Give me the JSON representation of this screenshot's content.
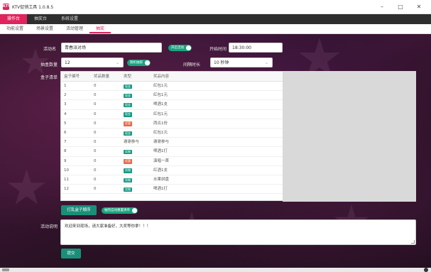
{
  "window": {
    "title": "KTV促销工具 1.0.8.5",
    "app_icon": "KTV"
  },
  "window_controls": {
    "minimize": "–",
    "maximize": "□",
    "close": "✕"
  },
  "topmenu": [
    {
      "label": "操作台",
      "active": true
    },
    {
      "label": "抽奖台",
      "active": false
    },
    {
      "label": "系统设置",
      "active": false
    }
  ],
  "subtabs": [
    {
      "label": "功能设置",
      "active": false
    },
    {
      "label": "场景设置",
      "active": false
    },
    {
      "label": "活动管理",
      "active": false
    },
    {
      "label": "抽奖",
      "active": true
    }
  ],
  "form": {
    "activity_name_label": "活动名",
    "activity_name_value": "青春派对场",
    "activity_toggle": "开启活动",
    "start_time_label": "开始时间",
    "start_time_value": "18:30:00",
    "box_count_label": "抽盒数量",
    "box_count_value": "12",
    "random_toggle": "随机抽取",
    "interval_label": "间隔时长",
    "interval_value": "10 秒钟",
    "table_label": "盒子清单",
    "description_label": "活动说明",
    "description_value": "欢迎来到现场，请大家准备好，大奖等你拿！！！"
  },
  "table": {
    "columns": [
      "盒子编号",
      "奖品数量",
      "类型",
      "奖品内容"
    ],
    "rows": [
      {
        "no": "1",
        "qty": "0",
        "type": "现金",
        "type_color": "#1a9a85",
        "content": "红包1元"
      },
      {
        "no": "2",
        "qty": "0",
        "type": "现金",
        "type_color": "#1a9a85",
        "content": "红包1元"
      },
      {
        "no": "3",
        "qty": "0",
        "type": "现金",
        "type_color": "#1a9a85",
        "content": "啤酒1支"
      },
      {
        "no": "4",
        "qty": "0",
        "type": "现金",
        "type_color": "#1a9a85",
        "content": "红包1元"
      },
      {
        "no": "5",
        "qty": "0",
        "type": "优惠",
        "type_color": "#e86a4a",
        "content": "西瓜1份"
      },
      {
        "no": "6",
        "qty": "0",
        "type": "现金",
        "type_color": "#1a9a85",
        "content": "红包1元"
      },
      {
        "no": "7",
        "qty": "0",
        "type": "谢谢参与",
        "type_color": "",
        "content": "谢谢参与"
      },
      {
        "no": "8",
        "qty": "0",
        "type": "实物",
        "type_color": "#1a9a85",
        "content": "啤酒1打"
      },
      {
        "no": "9",
        "qty": "0",
        "type": "优惠",
        "type_color": "#e86a4a",
        "content": "演唱一首"
      },
      {
        "no": "10",
        "qty": "0",
        "type": "实物",
        "type_color": "#1a9a85",
        "content": "红酒1支"
      },
      {
        "no": "11",
        "qty": "0",
        "type": "实物",
        "type_color": "#1a9a85",
        "content": "水果拼盘"
      },
      {
        "no": "12",
        "qty": "0",
        "type": "实物",
        "type_color": "#1a9a85",
        "content": "啤酒1打"
      }
    ]
  },
  "actions": {
    "open_all_button": "打乱盒子顺序",
    "auto_toggle": "抽完自动重置清单",
    "submit_button": "提交"
  },
  "colors": {
    "accent": "#e0245e",
    "primary": "#1a8f78",
    "toggle": "#19a47e"
  }
}
